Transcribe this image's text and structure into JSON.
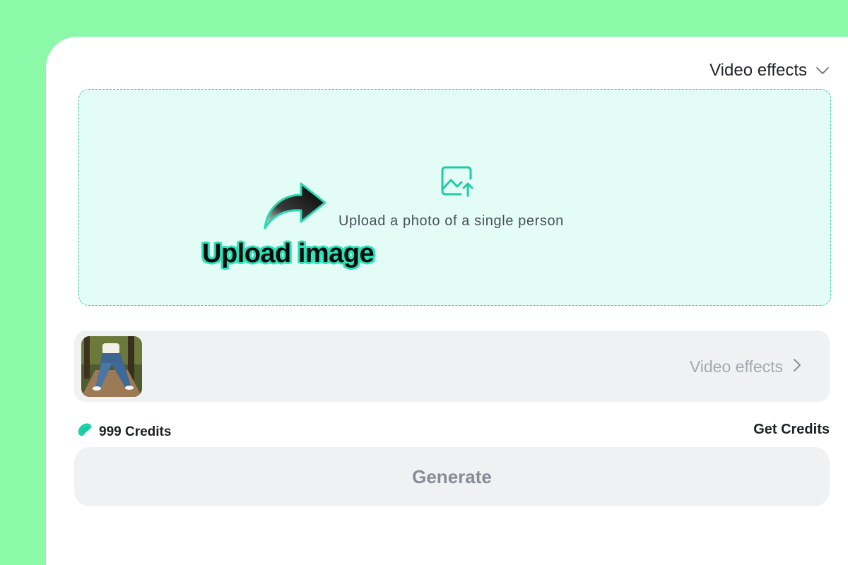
{
  "header": {
    "dropdown_label": "Video effects"
  },
  "upload": {
    "hint": "Upload a photo of a single person",
    "callout": "Upload image"
  },
  "effect_selector": {
    "label": "Video effects"
  },
  "credits": {
    "amount_label": "999 Credits",
    "get_label": "Get Credits"
  },
  "actions": {
    "generate_label": "Generate"
  },
  "icons": {
    "dropdown": "chevron-down-icon",
    "upload": "image-upload-icon",
    "callout_arrow": "curved-arrow-icon",
    "row_chevron": "chevron-right-icon",
    "credits": "bean-icon"
  },
  "colors": {
    "background": "#8cf9a9",
    "accent": "#2fcfab",
    "dropzone_fill": "#e4fcf6",
    "muted": "#a4a9b1"
  }
}
